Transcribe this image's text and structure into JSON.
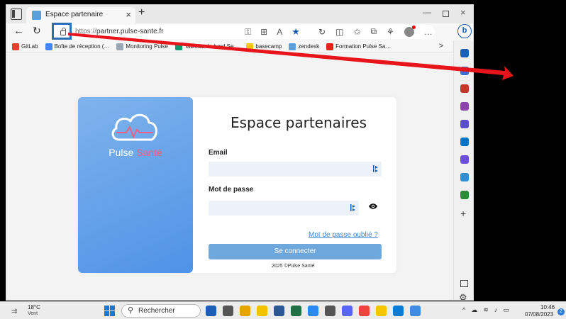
{
  "colors": {
    "accent": "#2a6eb4",
    "brand_panel": "#5a9be8",
    "brand_accent": "#f06080",
    "button": "#6fa8dc",
    "link": "#3d84d6",
    "field_bg": "#edf2f8",
    "annotation_arrow": "#e8141c"
  },
  "tab": {
    "title": "Espace partenaire",
    "close": "×",
    "new": "+"
  },
  "window": {
    "minimize": "—",
    "close": "×"
  },
  "toolbar": {
    "back": "←",
    "reload": "↻",
    "url_protocol": "https://",
    "url_host": "partner.pulse-sante.fr",
    "more": "…",
    "bing": "b"
  },
  "bookmarks": [
    {
      "label": "GitLab",
      "icon": "gitlab-icon",
      "color": "#e24329"
    },
    {
      "label": "Boîte de réception (…",
      "icon": "google-icon",
      "color": "#4285f4"
    },
    {
      "label": "Monitoring Pulse",
      "icon": "cloud-icon",
      "color": "#9aa7b5"
    },
    {
      "label": "Tableau de bord Se…",
      "icon": "sendinblue-icon",
      "color": "#0b996e"
    },
    {
      "label": "basecamp",
      "icon": "basecamp-icon",
      "color": "#f5c518"
    },
    {
      "label": "zendesk",
      "icon": "zendesk-icon",
      "color": "#5aa0dc"
    },
    {
      "label": "Formation Pulse Sa…",
      "icon": "youtube-icon",
      "color": "#e62117"
    }
  ],
  "bookmarks_more": ">",
  "login": {
    "brand_name_main": "Pulse",
    "brand_name_accent": "Santé",
    "title": "Espace partenaires",
    "email_label": "Email",
    "email_value": "",
    "password_label": "Mot de passe",
    "password_value": "",
    "forgot_link": "Mot de passe oublié ?",
    "submit": "Se connecter",
    "copyright": "2025 ©Pulse Santé"
  },
  "sidebar": {
    "icons": [
      {
        "name": "search-icon",
        "color": "#1a5fb4"
      },
      {
        "name": "tag-icon",
        "color": "#3b6fd8"
      },
      {
        "name": "briefcase-icon",
        "color": "#c0392b"
      },
      {
        "name": "people-icon",
        "color": "#8e44ad"
      },
      {
        "name": "office-icon",
        "color": "#5b4fc7"
      },
      {
        "name": "outlook-icon",
        "color": "#0072c6"
      },
      {
        "name": "drop-icon",
        "color": "#6a4fd8"
      },
      {
        "name": "sale-icon",
        "color": "#2f8fcf"
      },
      {
        "name": "tree-icon",
        "color": "#2e8b3a"
      }
    ],
    "add": "+",
    "settings": "⚙"
  },
  "taskbar": {
    "temperature": "18°C",
    "condition": "Vent",
    "search_label": "Rechercher",
    "time": "10:46",
    "date": "07/08/2023",
    "notifications": "2",
    "apps": [
      {
        "name": "bing-app-icon",
        "color": "#1a5fb4"
      },
      {
        "name": "task-view-icon",
        "color": "#555555"
      },
      {
        "name": "chrome-icon",
        "color": "#e8a400"
      },
      {
        "name": "explorer-icon",
        "color": "#f3c300"
      },
      {
        "name": "word-icon",
        "color": "#2b5797"
      },
      {
        "name": "excel-icon",
        "color": "#1e7145"
      },
      {
        "name": "screenshot-icon",
        "color": "#2d89ef"
      },
      {
        "name": "store-icon",
        "color": "#555555"
      },
      {
        "name": "discord-icon",
        "color": "#5865f2"
      },
      {
        "name": "anydesk-icon",
        "color": "#ef443b"
      },
      {
        "name": "sticky-notes-icon",
        "color": "#f7c600"
      },
      {
        "name": "edge-icon",
        "color": "#0c7bd4"
      },
      {
        "name": "photos-icon",
        "color": "#3e8de0"
      }
    ]
  }
}
